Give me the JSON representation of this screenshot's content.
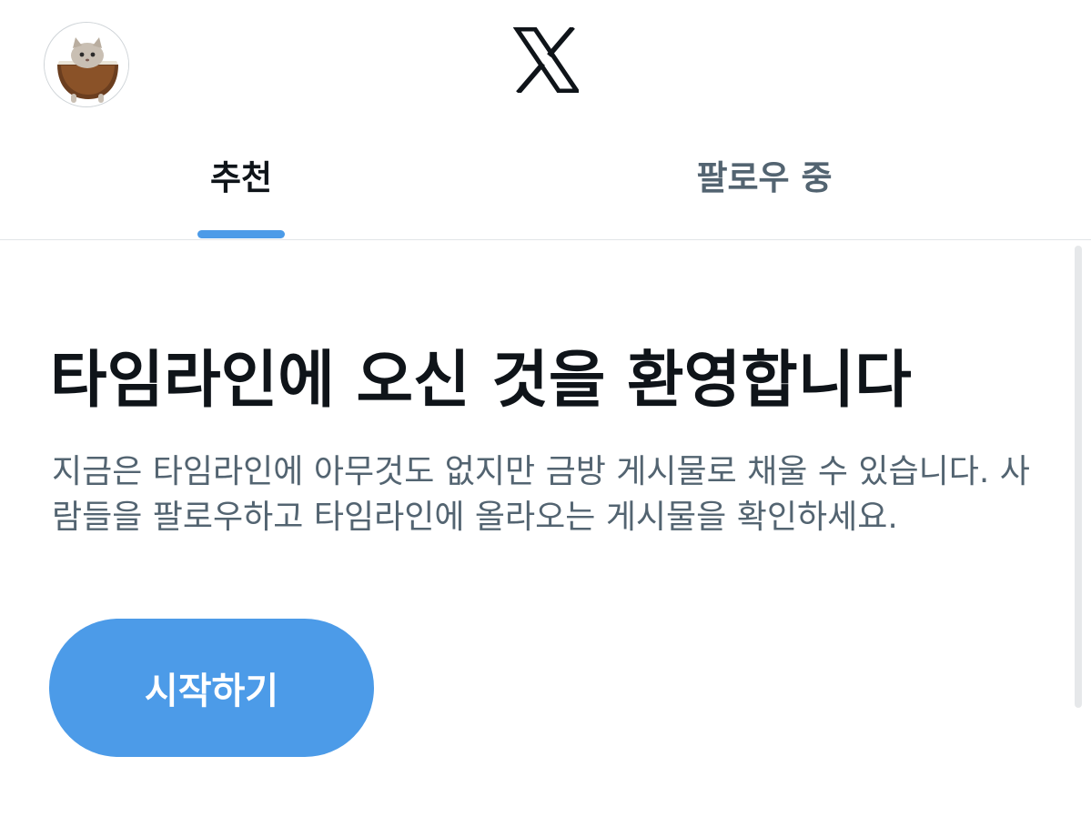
{
  "header": {
    "avatar_icon": "coconut-profile-image",
    "logo_icon": "x-logo"
  },
  "tabs": [
    {
      "label": "추천",
      "active": true
    },
    {
      "label": "팔로우 중",
      "active": false
    }
  ],
  "welcome": {
    "headline": "타임라인에 오신 것을 환영합니다",
    "description": "지금은 타임라인에 아무것도 없지만 금방 게시물로 채울 수 있습니다. 사람들을 팔로우하고 타임라인에 올라오는 게시물을 확인하세요.",
    "button_label": "시작하기"
  },
  "colors": {
    "accent": "#4c9be8",
    "text_primary": "#0f1419",
    "text_secondary": "#536471"
  }
}
